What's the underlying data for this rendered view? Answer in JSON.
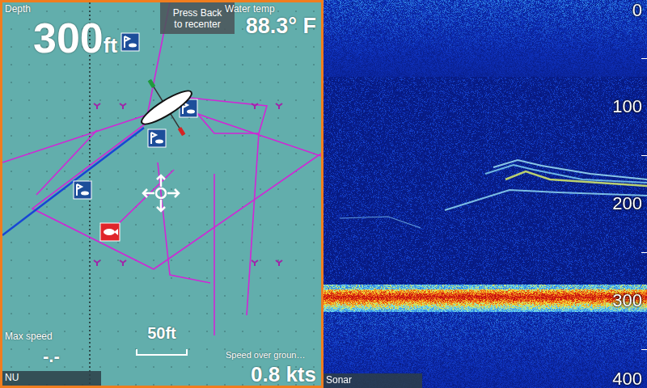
{
  "chart": {
    "depth": {
      "label": "Depth",
      "value": "300",
      "unit": "ft"
    },
    "notice": [
      "Press Back",
      "to recenter"
    ],
    "water_temp": {
      "label": "Water temp",
      "value": "88.3° F"
    },
    "max_speed": {
      "label": "Max speed",
      "value": "-.-"
    },
    "scale": "50ft",
    "speed": {
      "label": "Speed over groun…",
      "value": "0.8 kts"
    },
    "status_bar": "NU"
  },
  "sonar": {
    "label": "Sonar",
    "depth_ticks": [
      "0",
      "100",
      "200",
      "300",
      "400"
    ]
  }
}
